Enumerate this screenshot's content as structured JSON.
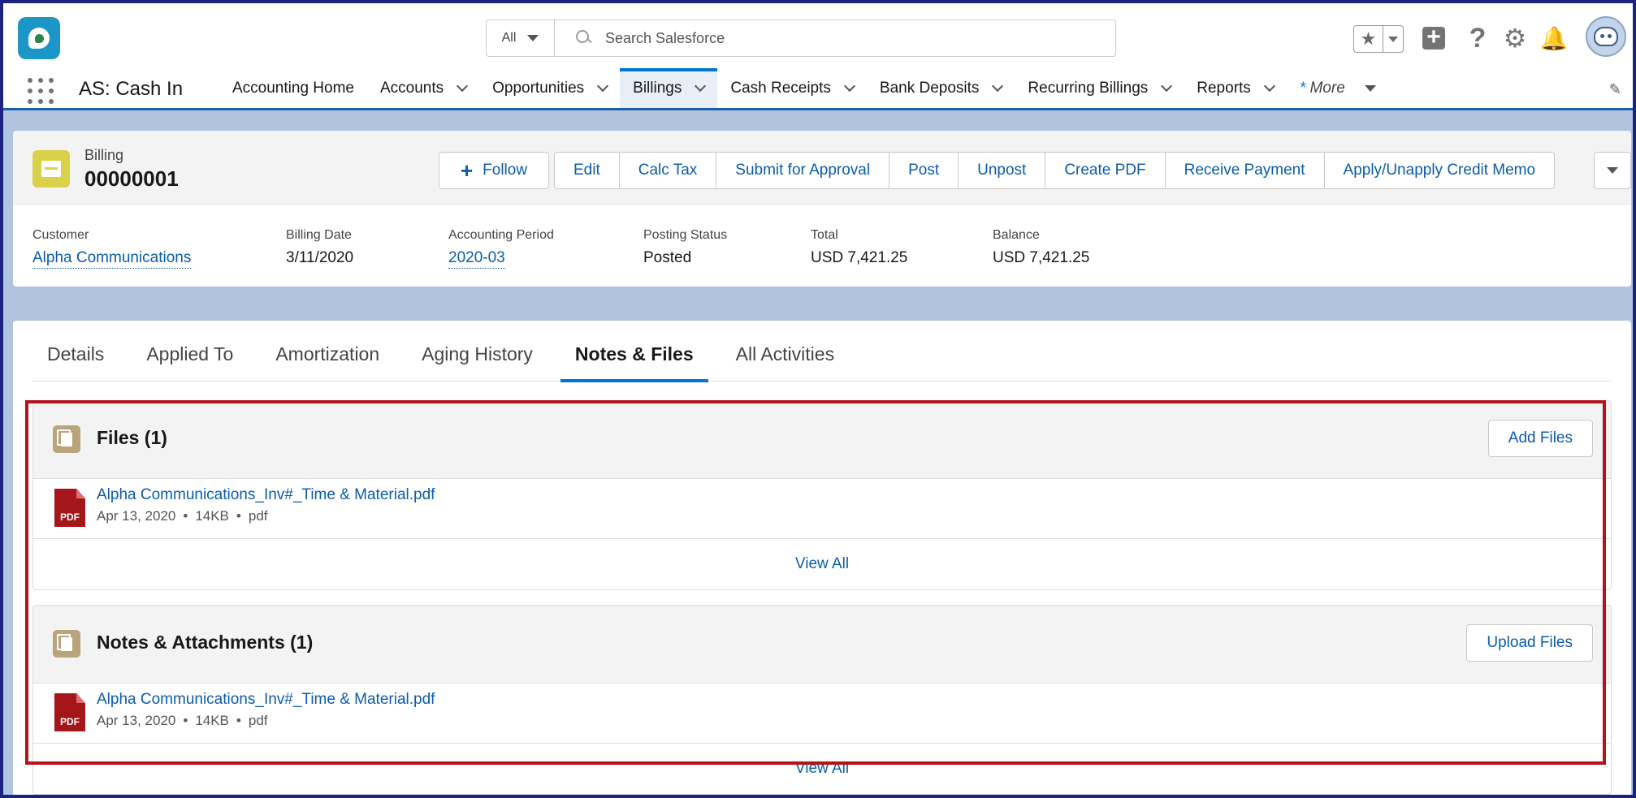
{
  "header": {
    "search_scope": "All",
    "search_placeholder": "Search Salesforce"
  },
  "nav": {
    "app_name": "AS: Cash In",
    "items": [
      {
        "label": "Accounting Home",
        "chevron": false
      },
      {
        "label": "Accounts",
        "chevron": true
      },
      {
        "label": "Opportunities",
        "chevron": true
      },
      {
        "label": "Billings",
        "chevron": true,
        "active": true
      },
      {
        "label": "Cash Receipts",
        "chevron": true
      },
      {
        "label": "Bank Deposits",
        "chevron": true
      },
      {
        "label": "Recurring Billings",
        "chevron": true
      },
      {
        "label": "Reports",
        "chevron": true
      }
    ],
    "more_asterisk": "*",
    "more_label": "More"
  },
  "record": {
    "type": "Billing",
    "name": "00000001",
    "follow_label": "Follow",
    "actions": [
      "Edit",
      "Calc Tax",
      "Submit for Approval",
      "Post",
      "Unpost",
      "Create PDF",
      "Receive Payment",
      "Apply/Unapply Credit Memo"
    ],
    "fields": [
      {
        "label": "Customer",
        "value": "Alpha Communications",
        "link": true
      },
      {
        "label": "Billing Date",
        "value": "3/11/2020",
        "link": false
      },
      {
        "label": "Accounting Period",
        "value": "2020-03",
        "link": true
      },
      {
        "label": "Posting Status",
        "value": "Posted",
        "link": false
      },
      {
        "label": "Total",
        "value": "USD 7,421.25",
        "link": false
      },
      {
        "label": "Balance",
        "value": "USD 7,421.25",
        "link": false
      }
    ]
  },
  "tabs": [
    "Details",
    "Applied To",
    "Amortization",
    "Aging History",
    "Notes & Files",
    "All Activities"
  ],
  "active_tab": "Notes & Files",
  "files_card": {
    "title": "Files (1)",
    "button": "Add Files",
    "file": {
      "name": "Alpha Communications_Inv#_Time & Material.pdf",
      "date": "Apr 13, 2020",
      "size": "14KB",
      "ext": "pdf",
      "badge": "PDF"
    },
    "view_all": "View All"
  },
  "notes_card": {
    "title": "Notes & Attachments (1)",
    "button": "Upload Files",
    "file": {
      "name": "Alpha Communications_Inv#_Time & Material.pdf",
      "date": "Apr 13, 2020",
      "size": "14KB",
      "ext": "pdf",
      "badge": "PDF"
    },
    "view_all": "View All"
  },
  "colors": {
    "brand_blue": "#0176d3",
    "link_blue": "#0b5cab",
    "highlight_red": "#b3121b",
    "frame_navy": "#1a237e"
  }
}
